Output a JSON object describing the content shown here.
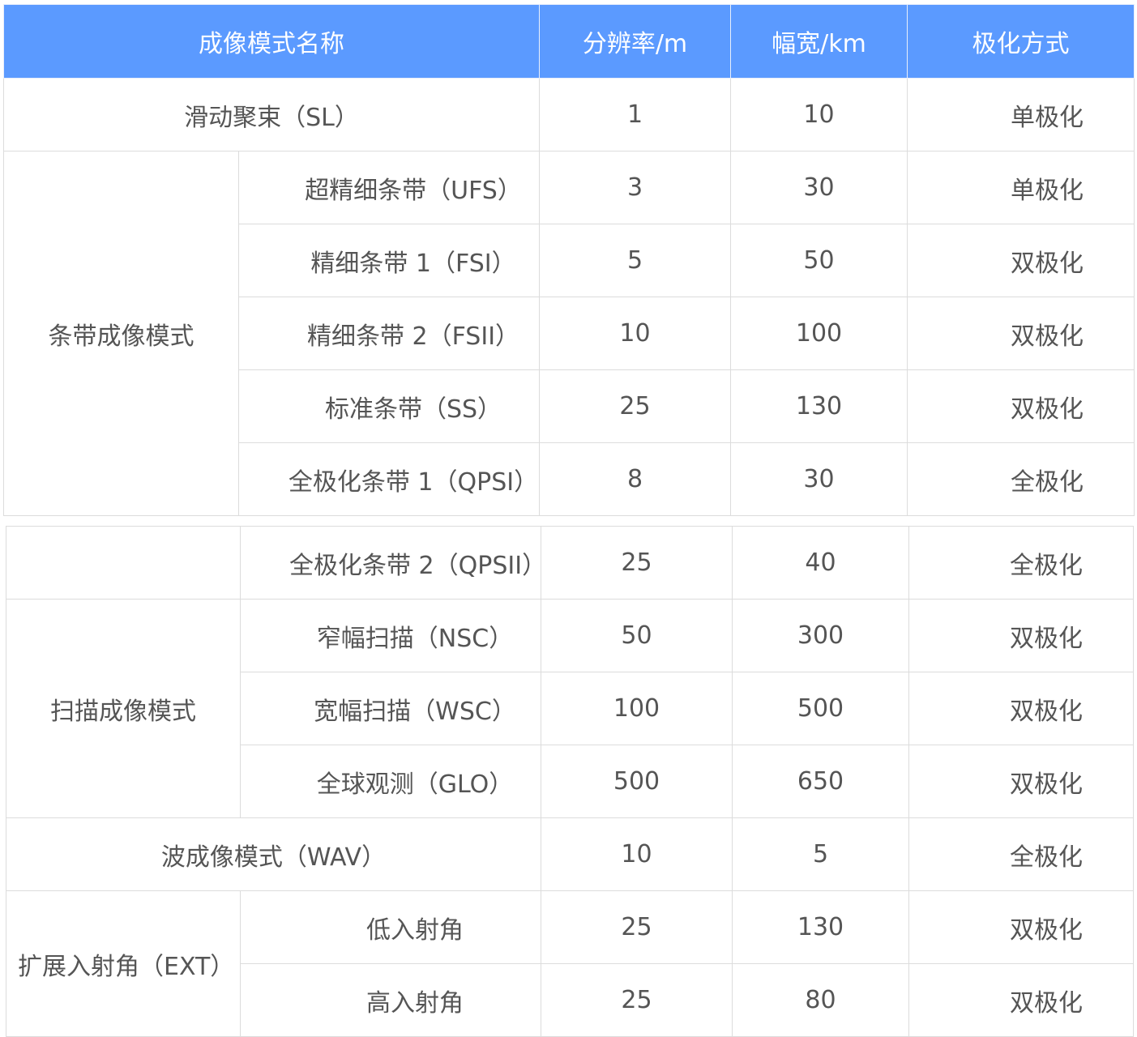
{
  "header": {
    "mode_name": "成像模式名称",
    "resolution": "分辨率/m",
    "swath": "幅宽/km",
    "polarization": "极化方式"
  },
  "rows_part1": [
    {
      "name": "滑动聚束（SL）",
      "resolution": "1",
      "swath": "10",
      "polarization": "单极化"
    },
    {
      "group": "条带成像模式",
      "name": "超精细条带（UFS）",
      "resolution": "3",
      "swath": "30",
      "polarization": "单极化"
    },
    {
      "name": "精细条带 1（FSI）",
      "resolution": "5",
      "swath": "50",
      "polarization": "双极化"
    },
    {
      "name": "精细条带 2（FSII）",
      "resolution": "10",
      "swath": "100",
      "polarization": "双极化"
    },
    {
      "name": "标准条带（SS）",
      "resolution": "25",
      "swath": "130",
      "polarization": "双极化"
    },
    {
      "name": "全极化条带 1（QPSI）",
      "resolution": "8",
      "swath": "30",
      "polarization": "全极化"
    }
  ],
  "rows_part2": [
    {
      "name": "全极化条带 2（QPSII）",
      "resolution": "25",
      "swath": "40",
      "polarization": "全极化"
    },
    {
      "group": "扫描成像模式",
      "name": "窄幅扫描（NSC）",
      "resolution": "50",
      "swath": "300",
      "polarization": "双极化"
    },
    {
      "name": "宽幅扫描（WSC）",
      "resolution": "100",
      "swath": "500",
      "polarization": "双极化"
    },
    {
      "name": "全球观测（GLO）",
      "resolution": "500",
      "swath": "650",
      "polarization": "双极化"
    },
    {
      "name": "波成像模式（WAV）",
      "resolution": "10",
      "swath": "5",
      "polarization": "全极化"
    },
    {
      "group": "扩展入射角（EXT）",
      "name": "低入射角",
      "resolution": "25",
      "swath": "130",
      "polarization": "双极化"
    },
    {
      "name": "高入射角",
      "resolution": "25",
      "swath": "80",
      "polarization": "双极化"
    }
  ],
  "colors": {
    "header_bg": "#5b9aff",
    "header_text": "#ffffff",
    "border": "#dcdcdc",
    "text": "#555555"
  }
}
